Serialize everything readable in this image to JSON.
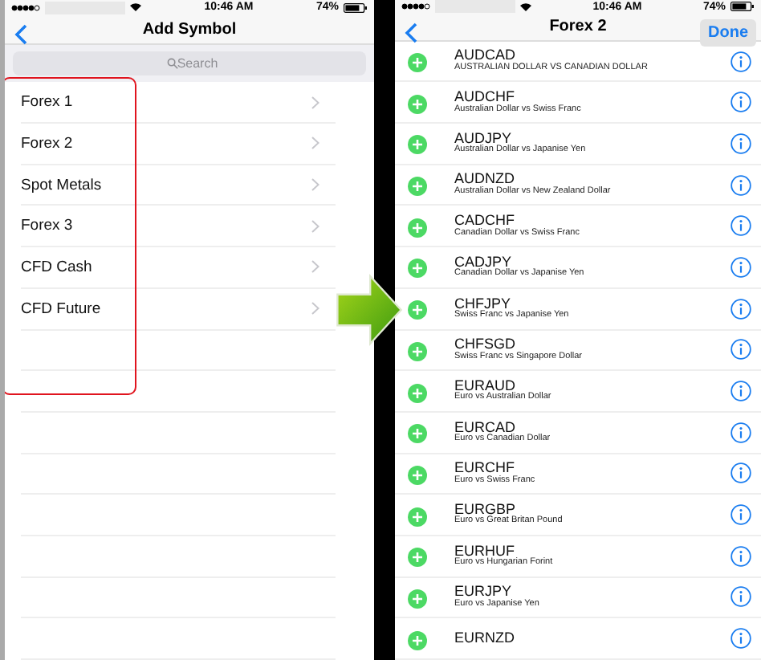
{
  "left_screen": {
    "status_bar": {
      "time": "10:46 AM",
      "battery": "74%"
    },
    "nav": {
      "title": "Add Symbol"
    },
    "search": {
      "placeholder": "Search"
    },
    "groups": [
      {
        "label": "Forex 1"
      },
      {
        "label": "Forex 2"
      },
      {
        "label": "Spot Metals"
      },
      {
        "label": "Forex 3"
      },
      {
        "label": "CFD Cash"
      },
      {
        "label": "CFD Future"
      }
    ]
  },
  "right_screen": {
    "status_bar": {
      "time": "10:46 AM",
      "battery": "74%"
    },
    "nav": {
      "title": "Forex 2",
      "done": "Done"
    },
    "symbols": [
      {
        "symbol": "AUDCAD",
        "description": "AUSTRALIAN DOLLAR VS CANADIAN DOLLAR"
      },
      {
        "symbol": "AUDCHF",
        "description": "Australian Dollar vs Swiss Franc"
      },
      {
        "symbol": "AUDJPY",
        "description": "Australian Dollar vs Japanise Yen"
      },
      {
        "symbol": "AUDNZD",
        "description": "Australian Dollar vs New Zealand Dollar"
      },
      {
        "symbol": "CADCHF",
        "description": "Canadian Dollar vs Swiss Franc"
      },
      {
        "symbol": "CADJPY",
        "description": "Canadian Dollar vs Japanise Yen"
      },
      {
        "symbol": "CHFJPY",
        "description": "Swiss Franc vs Japanise Yen"
      },
      {
        "symbol": "CHFSGD",
        "description": "Swiss Franc vs Singapore Dollar"
      },
      {
        "symbol": "EURAUD",
        "description": "Euro vs Australian Dollar"
      },
      {
        "symbol": "EURCAD",
        "description": "Euro vs Canadian Dollar"
      },
      {
        "symbol": "EURCHF",
        "description": "Euro vs Swiss Franc"
      },
      {
        "symbol": "EURGBP",
        "description": "Euro vs Great Britan Pound"
      },
      {
        "symbol": "EURHUF",
        "description": "Euro vs Hungarian Forint"
      },
      {
        "symbol": "EURJPY",
        "description": "Euro vs Japanise Yen"
      },
      {
        "symbol": "EURNZD"
      }
    ]
  }
}
